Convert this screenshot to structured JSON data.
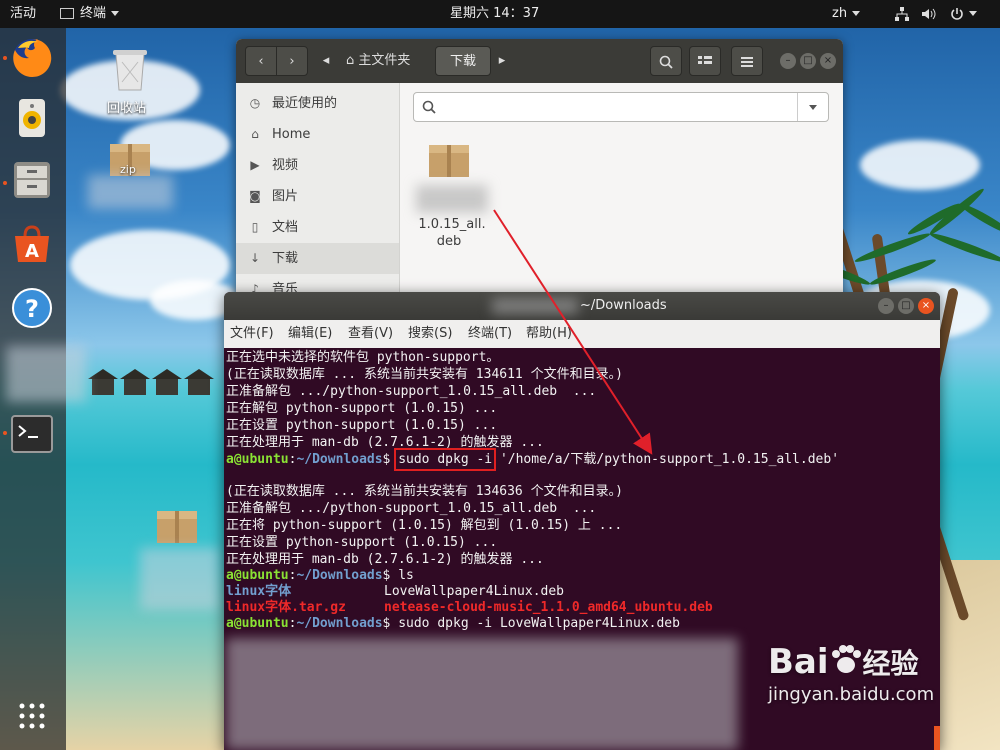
{
  "topbar": {
    "activities": "活动",
    "app_menu": "终端",
    "clock": "星期六 14：37",
    "lang": "zh"
  },
  "dock": {
    "apps": [
      "firefox-icon",
      "rhythmbox-icon",
      "files-icon",
      "software-icon",
      "help-icon",
      "terminal-icon"
    ]
  },
  "desktop": {
    "trash_label": "回收站",
    "zip_label": "zip"
  },
  "file_manager": {
    "path_home": "主文件夹",
    "path_current": "下载",
    "sidebar": [
      {
        "label": "最近使用的",
        "icon": "clock-icon"
      },
      {
        "label": "Home",
        "icon": "home-icon"
      },
      {
        "label": "视频",
        "icon": "video-icon"
      },
      {
        "label": "图片",
        "icon": "camera-icon"
      },
      {
        "label": "文档",
        "icon": "document-icon"
      },
      {
        "label": "下载",
        "icon": "download-icon"
      },
      {
        "label": "音乐",
        "icon": "music-icon"
      }
    ],
    "file": {
      "name_line1": "1.0.15_all.",
      "name_line2": "deb"
    }
  },
  "terminal": {
    "title": "~/Downloads",
    "menu": [
      "文件(F)",
      "编辑(E)",
      "查看(V)",
      "搜索(S)",
      "终端(T)",
      "帮助(H)"
    ],
    "lines1": [
      "正在选中未选择的软件包 python-support。",
      "(正在读取数据库 ... 系统当前共安装有 134611 个文件和目录。)",
      "正准备解包 .../python-support_1.0.15_all.deb  ...",
      "正在解包 python-support (1.0.15) ...",
      "正在设置 python-support (1.0.15) ...",
      "正在处理用于 man-db (2.7.6.1-2) 的触发器 ..."
    ],
    "prompt_user": "a@ubuntu",
    "prompt_path": "~/Downloads",
    "cmd1_highlight": "sudo dpkg -i",
    "cmd1_rest": " '/home/a/下载/python-support_1.0.15_all.deb'",
    "lines2": [
      "(正在读取数据库 ... 系统当前共安装有 134636 个文件和目录。)",
      "正准备解包 .../python-support_1.0.15_all.deb  ...",
      "正在将 python-support (1.0.15) 解包到 (1.0.15) 上 ...",
      "正在设置 python-support (1.0.15) ...",
      "正在处理用于 man-db (2.7.6.1-2) 的触发器 ..."
    ],
    "cmd2": "ls",
    "ls": {
      "dir1": "linux字体",
      "file1": "LoveWallpaper4Linux.deb",
      "arch1": "linux字体.tar.gz",
      "arch2": "netease-cloud-music_1.1.0_amd64_ubuntu.deb"
    },
    "cmd3": "sudo dpkg -i LoveWallpaper4Linux.deb"
  },
  "watermark": {
    "brand": "Bai",
    "brand2": "经验",
    "url": "jingyan.baidu.com"
  },
  "colors": {
    "accent": "#e95420",
    "terminal_bg": "#300a24",
    "highlight_box": "#e02020",
    "arrow": "#e0202a"
  }
}
